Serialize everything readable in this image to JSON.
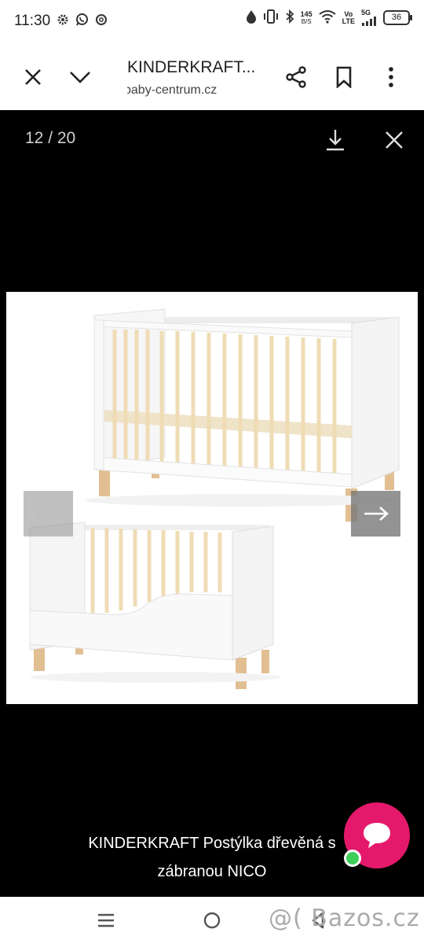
{
  "status_bar": {
    "time": "11:30",
    "left_icons": [
      "gear-icon",
      "whatsapp-icon",
      "settings-icon"
    ],
    "net_speed_top": "145",
    "net_speed_bottom": "B/S",
    "volte_top": "Vo",
    "volte_bottom": "LTE",
    "network": "5G",
    "battery": "36"
  },
  "toolbar": {
    "title": "KINDERKRAFT...",
    "url": "baby-centrum.cz"
  },
  "viewer": {
    "counter": "12 / 20",
    "caption_line1": "KINDERKRAFT Postýlka dřevěná s",
    "caption_line2": "zábranou NICO",
    "image_alt": "KINDERKRAFT Postýlka dřevěná se zábranou NICO"
  },
  "watermark": "@( Bazos.cz",
  "colors": {
    "chat_button": "#e4196b",
    "online_dot": "#3ecf5a",
    "viewer_bg": "#000000"
  }
}
